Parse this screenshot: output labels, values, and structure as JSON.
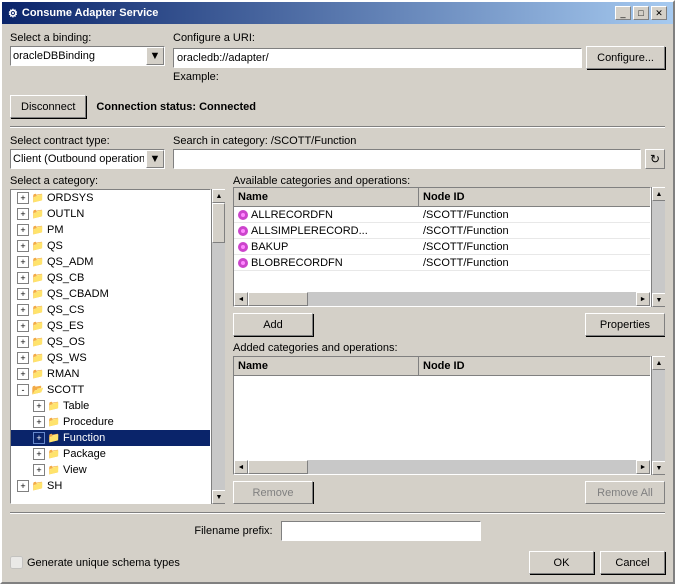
{
  "window": {
    "title": "Consume Adapter Service",
    "controls": [
      "_",
      "□",
      "✕"
    ]
  },
  "binding": {
    "label": "Select a binding:",
    "value": "oracleDBBinding",
    "dropdown_arrow": "▼"
  },
  "uri": {
    "label": "Configure a URI:",
    "value": "oracledb://adapter/",
    "example_label": "Example:",
    "configure_btn": "Configure..."
  },
  "connection": {
    "disconnect_btn": "Disconnect",
    "status_prefix": "Connection status:",
    "status_value": "Connected"
  },
  "contract": {
    "label": "Select contract type:",
    "value": "Client (Outbound operation:"
  },
  "search": {
    "label": "Search in category:",
    "category": "/SCOTT/Function",
    "placeholder": ""
  },
  "category": {
    "label": "Select a category:"
  },
  "tree_items": [
    {
      "id": "ORDSYS",
      "level": 1,
      "expanded": false,
      "label": "ORDSYS"
    },
    {
      "id": "OUTLN",
      "level": 1,
      "expanded": false,
      "label": "OUTLN"
    },
    {
      "id": "PM",
      "level": 1,
      "expanded": false,
      "label": "PM"
    },
    {
      "id": "QS",
      "level": 1,
      "expanded": false,
      "label": "QS"
    },
    {
      "id": "QS_ADM",
      "level": 1,
      "expanded": false,
      "label": "QS_ADM"
    },
    {
      "id": "QS_CB",
      "level": 1,
      "expanded": false,
      "label": "QS_CB"
    },
    {
      "id": "QS_CBADM",
      "level": 1,
      "expanded": false,
      "label": "QS_CBADM"
    },
    {
      "id": "QS_CS",
      "level": 1,
      "expanded": false,
      "label": "QS_CS"
    },
    {
      "id": "QS_ES",
      "level": 1,
      "expanded": false,
      "label": "QS_ES"
    },
    {
      "id": "QS_OS",
      "level": 1,
      "expanded": false,
      "label": "QS_OS"
    },
    {
      "id": "QS_WS",
      "level": 1,
      "expanded": false,
      "label": "QS_WS"
    },
    {
      "id": "RMAN",
      "level": 1,
      "expanded": false,
      "label": "RMAN"
    },
    {
      "id": "SCOTT",
      "level": 1,
      "expanded": true,
      "label": "SCOTT"
    },
    {
      "id": "Table",
      "level": 2,
      "expanded": false,
      "label": "Table"
    },
    {
      "id": "Procedure",
      "level": 2,
      "expanded": false,
      "label": "Procedure"
    },
    {
      "id": "Function",
      "level": 2,
      "expanded": false,
      "label": "Function",
      "selected": true
    },
    {
      "id": "Package",
      "level": 2,
      "expanded": false,
      "label": "Package"
    },
    {
      "id": "View",
      "level": 2,
      "expanded": false,
      "label": "View"
    },
    {
      "id": "SH",
      "level": 1,
      "expanded": false,
      "label": "SH"
    }
  ],
  "available": {
    "label": "Available categories and operations:",
    "columns": [
      "Name",
      "Node ID"
    ],
    "rows": [
      {
        "name": "ALLRECORDFN",
        "node_id": "/SCOTT/Function",
        "icon": true
      },
      {
        "name": "ALLSIMPLERECORD...",
        "node_id": "/SCOTT/Function",
        "icon": true
      },
      {
        "name": "BAKUP",
        "node_id": "/SCOTT/Function",
        "icon": true
      },
      {
        "name": "BLOBRECORDFN",
        "node_id": "/SCOTT/Function",
        "icon": true
      }
    ],
    "add_btn": "Add",
    "properties_btn": "Properties"
  },
  "added": {
    "label": "Added categories and operations:",
    "columns": [
      "Name",
      "Node ID"
    ],
    "rows": [],
    "remove_btn": "Remove",
    "remove_all_btn": "Remove All"
  },
  "filename": {
    "label": "Filename prefix:"
  },
  "footer": {
    "checkbox_label": "Generate unique schema types",
    "ok_btn": "OK",
    "cancel_btn": "Cancel"
  }
}
